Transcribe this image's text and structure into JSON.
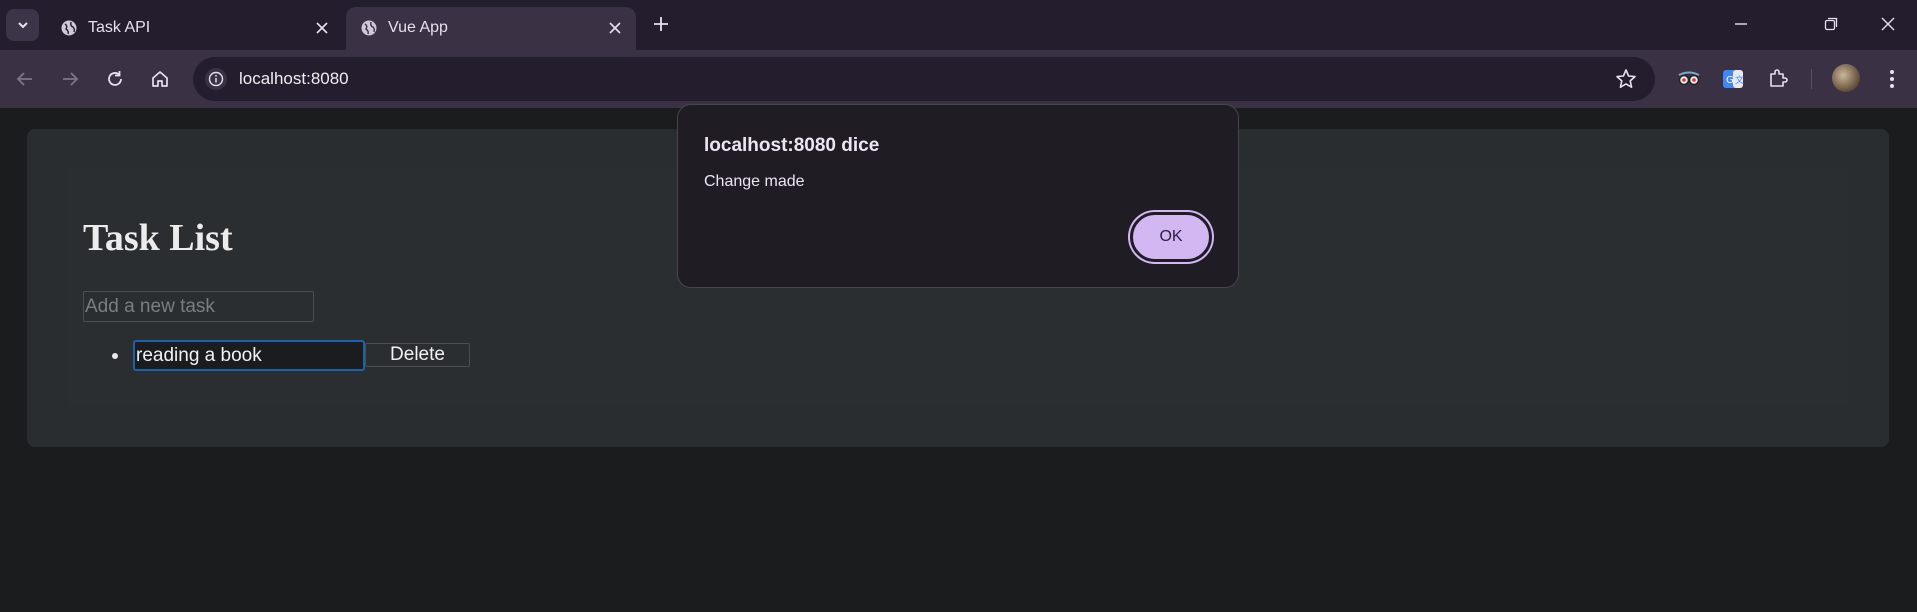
{
  "browser": {
    "tabs": [
      {
        "title": "Task API",
        "active": false
      },
      {
        "title": "Vue App",
        "active": true
      }
    ],
    "address": "localhost:8080",
    "icons": [
      "tab-search-icon",
      "globe-icon",
      "close-icon",
      "plus-icon",
      "minimize-icon",
      "restore-icon",
      "back-icon",
      "forward-icon",
      "reload-icon",
      "home-icon",
      "info-icon",
      "star-icon",
      "extension-icon",
      "menu-icon"
    ]
  },
  "page": {
    "title": "Task List",
    "new_task_placeholder": "Add a new task",
    "tasks": [
      {
        "text": "reading a book",
        "delete_label": "Delete"
      }
    ]
  },
  "dialog": {
    "title": "localhost:8080 dice",
    "message": "Change made",
    "ok_label": "OK"
  },
  "colors": {
    "accent": "#d3b7f3",
    "chrome": "#3a3145",
    "focus_border": "#1e5fb0"
  }
}
